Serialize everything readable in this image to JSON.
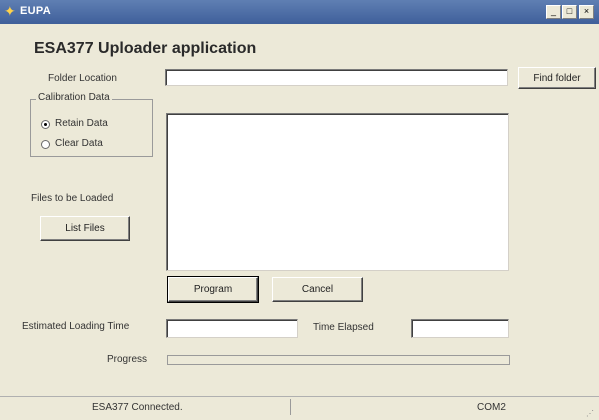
{
  "window": {
    "title": "EUPA",
    "controls": {
      "minimize": "_",
      "maximize": "□",
      "close": "×"
    }
  },
  "app_title": "ESA377 Uploader application",
  "folder": {
    "label": "Folder Location",
    "value": "",
    "find_button": "Find folder"
  },
  "calibration": {
    "title": "Calibration Data",
    "options": [
      {
        "label": "Retain Data",
        "selected": true
      },
      {
        "label": "Clear Data",
        "selected": false
      }
    ]
  },
  "files": {
    "label": "Files to be Loaded",
    "list_button": "List Files",
    "items": []
  },
  "actions": {
    "program": "Program",
    "cancel": "Cancel"
  },
  "timing": {
    "estimated_label": "Estimated Loading Time",
    "estimated_value": "",
    "elapsed_label": "Time Elapsed",
    "elapsed_value": ""
  },
  "progress": {
    "label": "Progress",
    "value": 0
  },
  "status": {
    "connection": "ESA377 Connected.",
    "port": "COM2"
  },
  "colors": {
    "titlebar": "#3f5f9a",
    "window_bg": "#ece9d8"
  }
}
